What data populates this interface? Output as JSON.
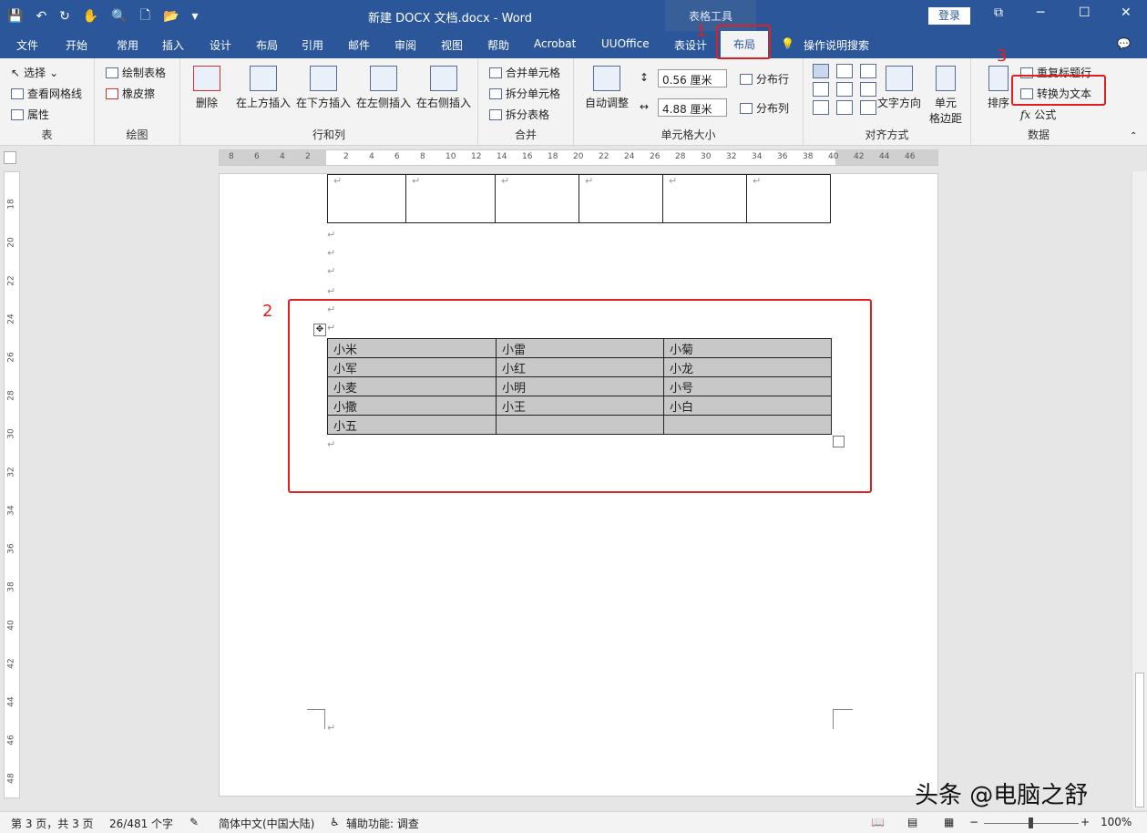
{
  "title": "新建 DOCX 文档.docx  -  Word",
  "context_group": "表格工具",
  "login": "登录",
  "tabs": [
    "文件",
    "开始",
    "常用",
    "插入",
    "设计",
    "布局",
    "引用",
    "邮件",
    "审阅",
    "视图",
    "帮助",
    "Acrobat",
    "UUOffice",
    "表设计",
    "布局",
    "操作说明搜索"
  ],
  "ribbon": {
    "table": {
      "label": "表",
      "select": "选择",
      "gridlines": "查看网格线",
      "properties": "属性"
    },
    "draw": {
      "label": "绘图",
      "draw_table": "绘制表格",
      "eraser": "橡皮擦"
    },
    "rows_cols": {
      "label": "行和列",
      "delete": "删除",
      "above": "在上方插入",
      "below": "在下方插入",
      "left": "在左侧插入",
      "right": "在右侧插入"
    },
    "merge": {
      "label": "合并",
      "merge": "合并单元格",
      "split": "拆分单元格",
      "split_table": "拆分表格"
    },
    "size": {
      "label": "单元格大小",
      "auto": "自动调整",
      "height": "0.56 厘米",
      "width": "4.88 厘米",
      "dist_rows": "分布行",
      "dist_cols": "分布列"
    },
    "align": {
      "label": "对齐方式",
      "direction": "文字方向",
      "margins_1": "单元",
      "margins_2": "格边距"
    },
    "data": {
      "label": "数据",
      "sort": "排序",
      "repeat": "重复标题行",
      "convert": "转换为文本",
      "formula": "公式"
    }
  },
  "annotations": [
    "1",
    "2",
    "3"
  ],
  "hruler_ticks": [
    "8",
    "6",
    "4",
    "2",
    "2",
    "4",
    "6",
    "8",
    "10",
    "12",
    "14",
    "16",
    "18",
    "20",
    "22",
    "24",
    "26",
    "28",
    "30",
    "32",
    "34",
    "36",
    "38",
    "40",
    "42",
    "44",
    "46"
  ],
  "vruler_ticks": [
    "18",
    "20",
    "22",
    "24",
    "26",
    "28",
    "30",
    "32",
    "34",
    "36",
    "38",
    "40",
    "42",
    "44",
    "46",
    "48"
  ],
  "table2": [
    [
      "小米",
      "小雷",
      "小菊"
    ],
    [
      "小军",
      "小红",
      "小龙"
    ],
    [
      "小麦",
      "小明",
      "小号"
    ],
    [
      "小撒",
      "小王",
      "小白"
    ],
    [
      "小五",
      "",
      ""
    ]
  ],
  "status": {
    "page": "第 3 页，共 3 页",
    "words": "26/481 个字",
    "lang": "简体中文(中国大陆)",
    "access": "辅助功能: 调查",
    "zoom": "100%"
  },
  "watermark": "头条 @电脑之舒"
}
